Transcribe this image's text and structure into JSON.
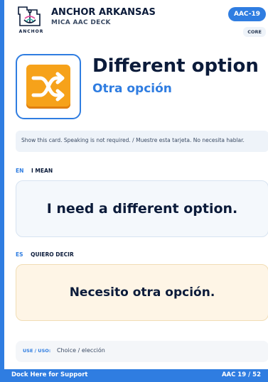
{
  "header": {
    "brand": "ANCHOR ARKANSAS",
    "subtitle": "MICA AAC DECK",
    "logo_text": "ANCHOR",
    "code_badge": "AAC-19",
    "category_badge": "CORE"
  },
  "card": {
    "icon": "shuffle-icon",
    "title_en": "Different option",
    "title_es": "Otra opción",
    "instruction": "Show this card. Speaking is not required. / Muestre esta tarjeta. No necesita hablar."
  },
  "english": {
    "code": "EN",
    "label": "I MEAN",
    "phrase": "I need a different option."
  },
  "spanish": {
    "code": "ES",
    "label": "QUIERO DECIR",
    "phrase": "Necesito otra opción."
  },
  "use": {
    "label": "USE / USO:",
    "value": "Choice / elección"
  },
  "footer": {
    "left": "Dock Here for Support",
    "right": "AAC 19 / 52"
  },
  "colors": {
    "accent": "#2f7de1",
    "navy": "#0b1b3a",
    "icon_orange": "#f6a21a",
    "spanish_bg": "#fef5e6"
  }
}
